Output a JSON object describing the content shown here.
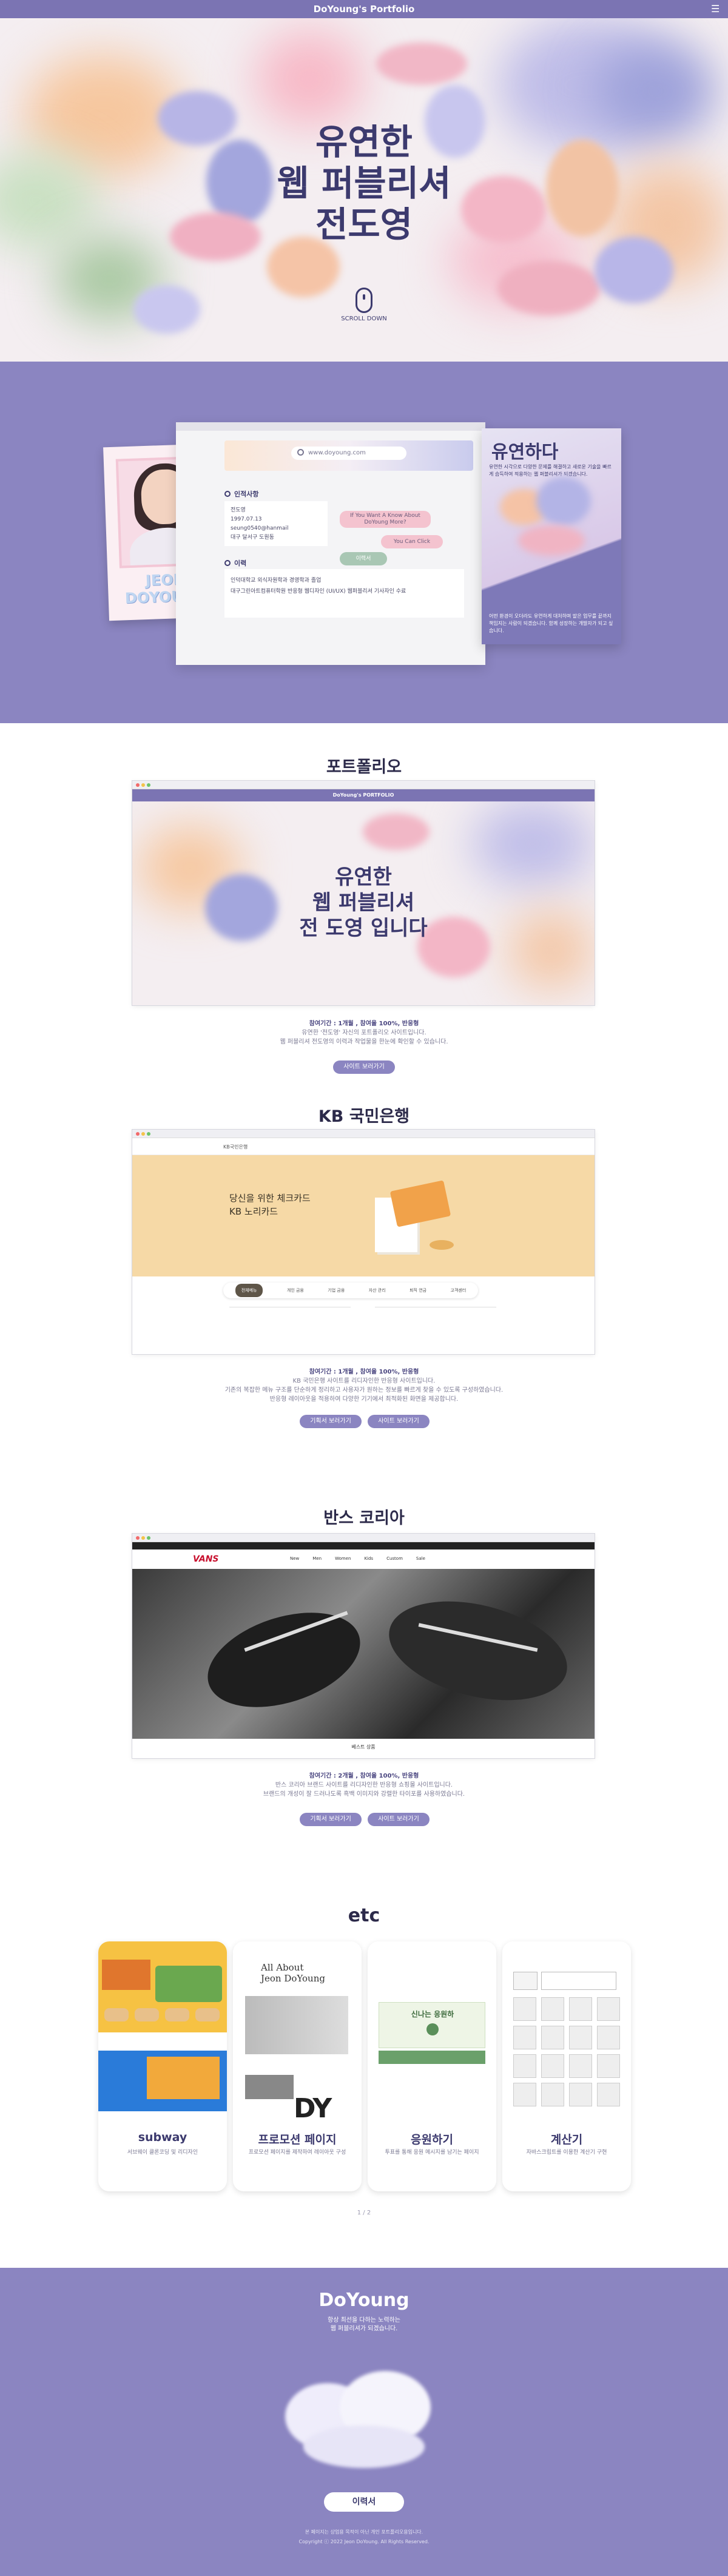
{
  "header": {
    "title": "DoYoung's Portfolio",
    "menu_icon": "hamburger-icon"
  },
  "hero": {
    "title_line1": "유연한",
    "title_line2": "웹 퍼블리셔",
    "title_line3": "전도영",
    "scroll_label": "SCROLL DOWN"
  },
  "about": {
    "photo_caption_1": "JEON",
    "photo_caption_2": "DOYOUNG",
    "search_placeholder": "www.doyoung.com",
    "info_title": "인적사항",
    "info_lines": [
      "전도영",
      "1997.07.13",
      "seung0540@hanmail",
      "대구 달서구 도원동"
    ],
    "pill_1": "If You Want A Know About DoYoung More?",
    "pill_2": "You Can Click",
    "pill_3": "이력서",
    "career_title": "이력",
    "career_lines": [
      "인덕대학교 외식자원학과 경영학과 졸업",
      "대구그린아트컴퓨터학원 반응형 웹디자인 (UI/UX) 웹퍼블리셔 기사자인 수료"
    ],
    "side_heading": "유연하다",
    "side_text_top": "유연한 시각으로 다양한 문제를 해결하고 새로운 기술을 빠르게 습득하여 적용하는 웹 퍼블리셔가 되겠습니다.",
    "side_text_bottom": "어떤 환경이 오더라도 유연하게 대처하며 맡은 업무를 끝까지 책임지는 사람이 되겠습니다. 함께 성장하는 개발자가 되고 싶습니다."
  },
  "portfolio": [
    {
      "title": "포트폴리오",
      "screen": {
        "bar_title": "DoYoung's PORTFOLIO",
        "hero_1": "유연한",
        "hero_2": "웹 퍼블리셔",
        "hero_3": "전 도영 입니다"
      },
      "meta": "참여기간 : 1개월 , 참여율 100%, 반응형",
      "desc_1": "유연한 '전도영' 자신의 포트폴리오 사이트입니다.",
      "desc_2": "웹 퍼블리셔 전도영의 이력과 작업물을 한눈에 확인할 수 있습니다.",
      "btn_1": "사이트 보러가기"
    },
    {
      "title": "KB 국민은행",
      "screen": {
        "logo": "KB국민은행",
        "headline_1": "당신을 위한 체크카드",
        "headline_2": "KB 노리카드",
        "tabs": [
          "전체메뉴",
          "개인 금융",
          "기업 금융",
          "자산 관리",
          "퇴직 연금",
          "고객센터"
        ]
      },
      "meta": "참여기간 : 1개월 , 참여율 100%, 반응형",
      "desc_1": "KB 국민은행 사이트를 리디자인한 반응형 사이트입니다.",
      "desc_2": "기존의 복잡한 메뉴 구조를 단순하게 정리하고 사용자가 원하는 정보를 빠르게 찾을 수 있도록 구성하였습니다.",
      "desc_3": "반응형 레이아웃을 적용하여 다양한 기기에서 최적화된 화면을 제공합니다.",
      "btn_1": "기획서 보러가기",
      "btn_2": "사이트 보러가기"
    },
    {
      "title": "반스 코리아",
      "screen": {
        "logo": "VANS",
        "nav": [
          "New",
          "Men",
          "Women",
          "Kids",
          "Custom",
          "Sale"
        ],
        "caption": "베스트 상품"
      },
      "meta": "참여기간 : 2개월 , 참여율 100%, 반응형",
      "desc_1": "반스 코리아 브랜드 사이트를 리디자인한 반응형 쇼핑몰 사이트입니다.",
      "desc_2": "브랜드의 개성이 잘 드러나도록 흑백 이미지와 강렬한 타이포를 사용하였습니다.",
      "btn_1": "기획서 보러가기",
      "btn_2": "사이트 보러가기"
    }
  ],
  "etc": {
    "title": "etc",
    "cards": [
      {
        "title": "subway",
        "desc": "서브웨이 클론코딩 및 리디자인"
      },
      {
        "title": "프로모션 페이지",
        "desc": "프로모션 페이지를 제작하여 레이아웃 구성"
      },
      {
        "title": "응원하기",
        "desc": "투표를 통해 응원 메시지를 남기는 페이지"
      },
      {
        "title": "계산기",
        "desc": "자바스크립트를 이용한 계산기 구현"
      }
    ],
    "promo_heading_1": "All About",
    "promo_heading_2": "Jeon DoYoung",
    "cheer_label": "신나는 응원하",
    "pagination": "1 / 2"
  },
  "footer": {
    "name": "DoYoung",
    "sub_1": "항상 최선을 다하는 노력하는",
    "sub_2": "웹 퍼블리셔가 되겠습니다.",
    "resume_btn": "이력서",
    "copy_1": "본 페이지는 상업용 목적이 아닌 개인 포트폴리오용입니다.",
    "copy_2": "Copyright ⓒ 2022 Jeon DoYoung. All Rights Reserved."
  },
  "colors": {
    "accent": "#8b85c1",
    "header": "#7b74b3",
    "text": "#2c2a4a"
  }
}
